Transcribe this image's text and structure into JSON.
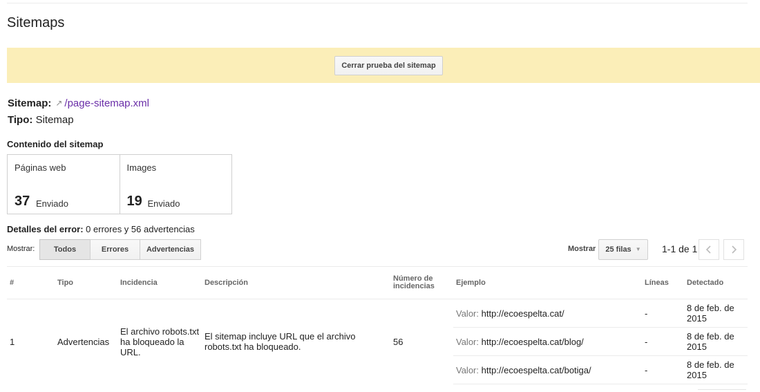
{
  "page": {
    "title": "Sitemaps"
  },
  "banner": {
    "close_button": "Cerrar prueba del sitemap"
  },
  "sitemap": {
    "label": "Sitemap:",
    "path": "/page-sitemap.xml",
    "type_label": "Tipo:",
    "type_value": "Sitemap"
  },
  "content": {
    "title": "Contenido del sitemap",
    "stats": [
      {
        "label": "Páginas web",
        "value": "37",
        "unit": "Enviado"
      },
      {
        "label": "Images",
        "value": "19",
        "unit": "Enviado"
      }
    ]
  },
  "errors": {
    "label": "Detalles del error:",
    "summary": "0 errores y 56 advertencias"
  },
  "filters": {
    "show_label": "Mostrar:",
    "options": [
      "Todos",
      "Errores",
      "Advertencias"
    ],
    "active": "Todos"
  },
  "pagination": {
    "show_label": "Mostrar",
    "rows": "25 filas",
    "range": "1-1 de 1"
  },
  "table": {
    "headers": [
      "#",
      "Tipo",
      "Incidencia",
      "Descripción",
      "Número de incidencias",
      "Ejemplo",
      "Líneas",
      "Detectado"
    ],
    "rows": [
      {
        "index": "1",
        "type": "Advertencias",
        "issue": "El archivo robots.txt ha bloqueado la URL.",
        "description": "El sitemap incluye URL que el archivo robots.txt ha bloqueado.",
        "count": "56",
        "examples": [
          {
            "key": "Valor:",
            "url": "http://ecoespelta.cat/",
            "lines": "-",
            "detected": "8 de feb. de 2015"
          },
          {
            "key": "Valor:",
            "url": "http://ecoespelta.cat/blog/",
            "lines": "-",
            "detected": "8 de feb. de 2015"
          },
          {
            "key": "Valor:",
            "url": "http://ecoespelta.cat/botiga/",
            "lines": "-",
            "detected": "8 de feb. de 2015"
          }
        ]
      }
    ]
  },
  "colors": {
    "banner_bg": "#fbeeb8",
    "link": "#6a2ea8"
  }
}
